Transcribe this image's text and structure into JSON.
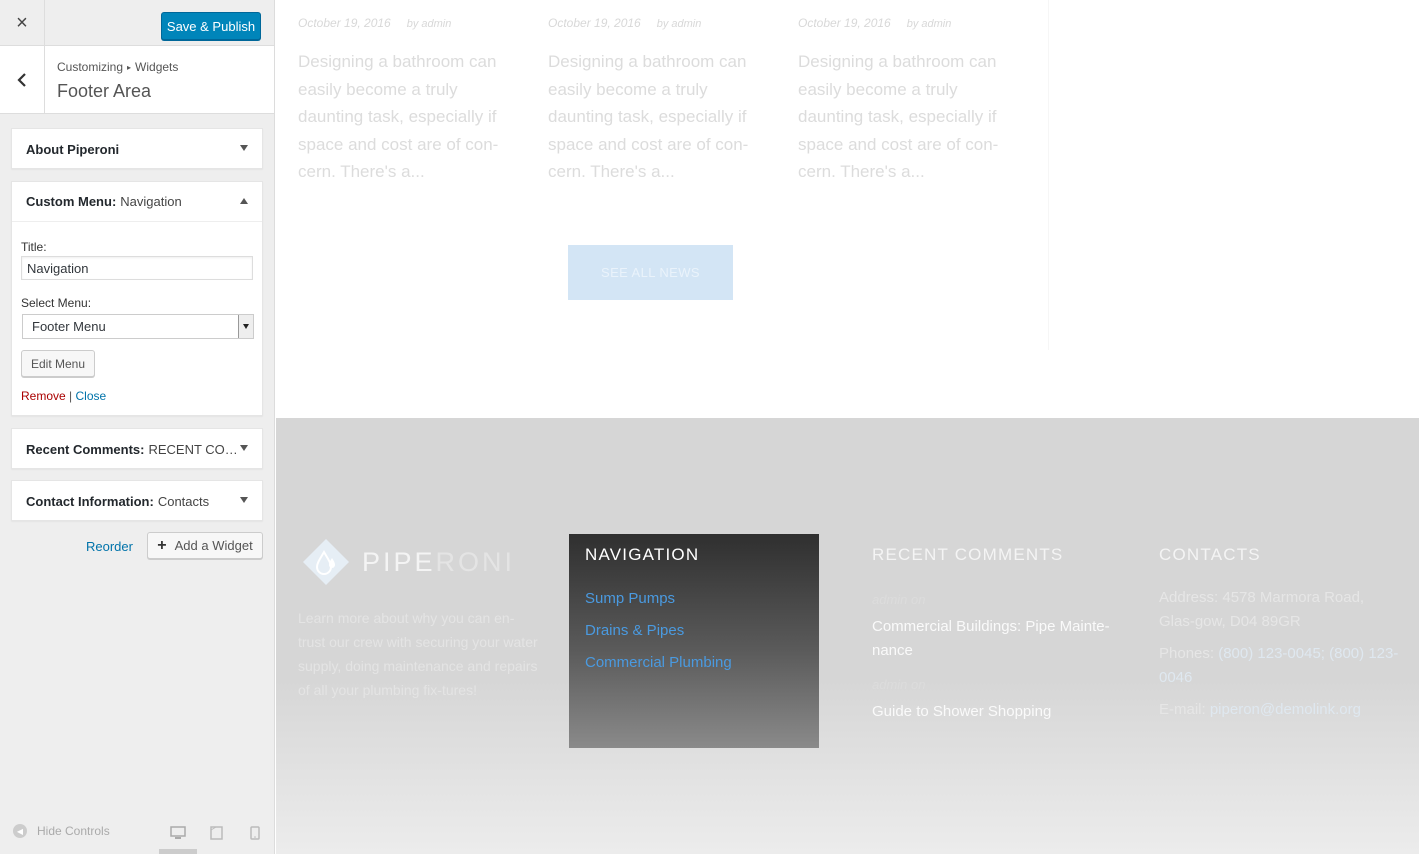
{
  "sidebar": {
    "close_icon": "×",
    "publish_label": "Save & Publish",
    "breadcrumb": {
      "root": "Customizing",
      "separator": "▸",
      "current": "Widgets"
    },
    "section_title": "Footer Area",
    "widgets": {
      "about": {
        "name": "About Piperoni",
        "subtitle": ""
      },
      "menu": {
        "name": "Custom Menu:",
        "subtitle": "Navigation",
        "title_label": "Title:",
        "title_value": "Navigation",
        "select_label": "Select Menu:",
        "select_value": "Footer Menu",
        "edit_button": "Edit Menu",
        "remove_link": "Remove",
        "link_separator": "|",
        "close_link": "Close"
      },
      "recent": {
        "name": "Recent Comments:",
        "subtitle": "RECENT COM..."
      },
      "contact": {
        "name": "Contact Information:",
        "subtitle": "Contacts"
      }
    },
    "reorder_label": "Reorder",
    "add_widget_label": "Add a Widget",
    "hide_controls_label": "Hide Controls"
  },
  "preview": {
    "posts": [
      {
        "date": "October 19, 2016",
        "author": "by admin",
        "excerpt": "Designing a bathroom can easily become a truly daunting task, especially if space and cost are of con-cern. There's a..."
      },
      {
        "date": "October 19, 2016",
        "author": "by admin",
        "excerpt": "Designing a bathroom can easily become a truly daunting task, especially if space and cost are of con-cern. There's a..."
      },
      {
        "date": "October 19, 2016",
        "author": "by admin",
        "excerpt": "Designing a bathroom can easily become a truly daunting task, especially if space and cost are of con-cern. There's a..."
      }
    ],
    "see_all_label": "SEE ALL NEWS",
    "footer": {
      "logo": {
        "part1": "PIPE",
        "part2": "RONI"
      },
      "about_text": "Learn more about why you can en-trust our crew with securing your water supply, doing maintenance and repairs of all your plumbing fix-tures!",
      "navigation": {
        "title": "NAVIGATION",
        "links": [
          "Sump Pumps",
          "Drains & Pipes",
          "Commercial Plumbing"
        ]
      },
      "recent_comments": {
        "title": "RECENT COMMENTS",
        "items": [
          {
            "meta": "admin on",
            "link": "Commercial Buildings: Pipe Mainte-nance"
          },
          {
            "meta": "admin on",
            "link": "Guide to Shower Shopping"
          }
        ]
      },
      "contacts": {
        "title": "CONTACTS",
        "address": "Address: 4578 Marmora Road, Glas-gow, D04 89GR",
        "phones_label": "Phones:",
        "phones": "(800) 123-0045; (800) 123-0046",
        "email_label": "E-mail:",
        "email": "piperon@demolink.org"
      }
    }
  },
  "colors": {
    "primary_button": "#0085ba",
    "link": "#0073aa",
    "remove": "#aa0000",
    "nav_link": "#4a9ae0"
  }
}
